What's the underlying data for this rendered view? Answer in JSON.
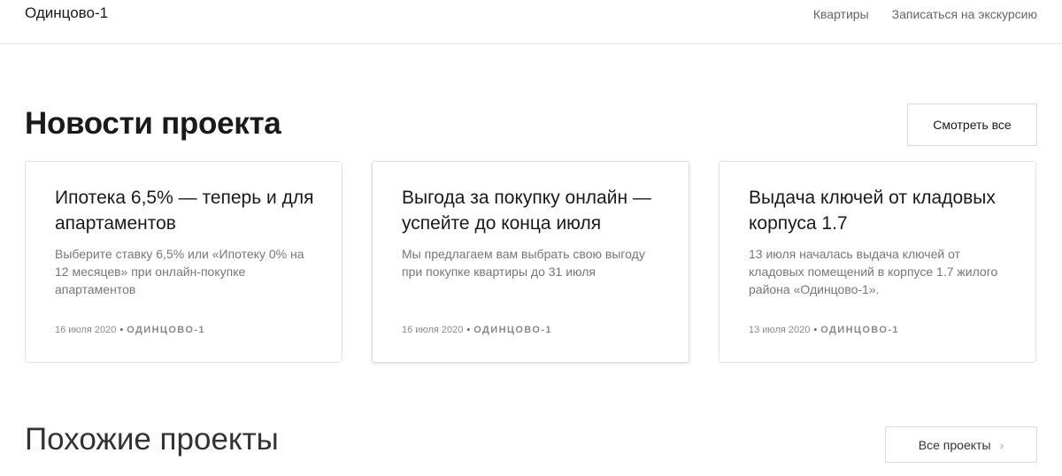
{
  "header": {
    "brand": "Одинцово-1",
    "nav": [
      {
        "label": "Квартиры"
      },
      {
        "label": "Записаться на экскурсию"
      }
    ]
  },
  "news": {
    "title": "Новости проекта",
    "see_all_label": "Смотреть все",
    "cards": [
      {
        "title": "Ипотека 6,5% — теперь и для апартаментов",
        "text": "Выберите ставку 6,5% или «Ипотеку 0% на 12 месяцев» при онлайн-покупке апартаментов",
        "date": "16 июля 2020",
        "project": "ОДИНЦОВО-1"
      },
      {
        "title": "Выгода за покупку онлайн — успейте до конца июля",
        "text": "Мы предлагаем вам выбрать свою выгоду при покупке квартиры до 31 июля",
        "date": "16 июля 2020",
        "project": "ОДИНЦОВО-1"
      },
      {
        "title": "Выдача ключей от кладовых корпуса 1.7",
        "text": "13 июля началась выдача ключей от кладовых помещений в корпусе 1.7 жилого района «Одинцово-1».",
        "date": "13 июля 2020",
        "project": "ОДИНЦОВО-1"
      }
    ]
  },
  "similar": {
    "title": "Похожие проекты",
    "all_projects_label": "Все проекты",
    "chevron_icon": "chevron-right-icon"
  }
}
